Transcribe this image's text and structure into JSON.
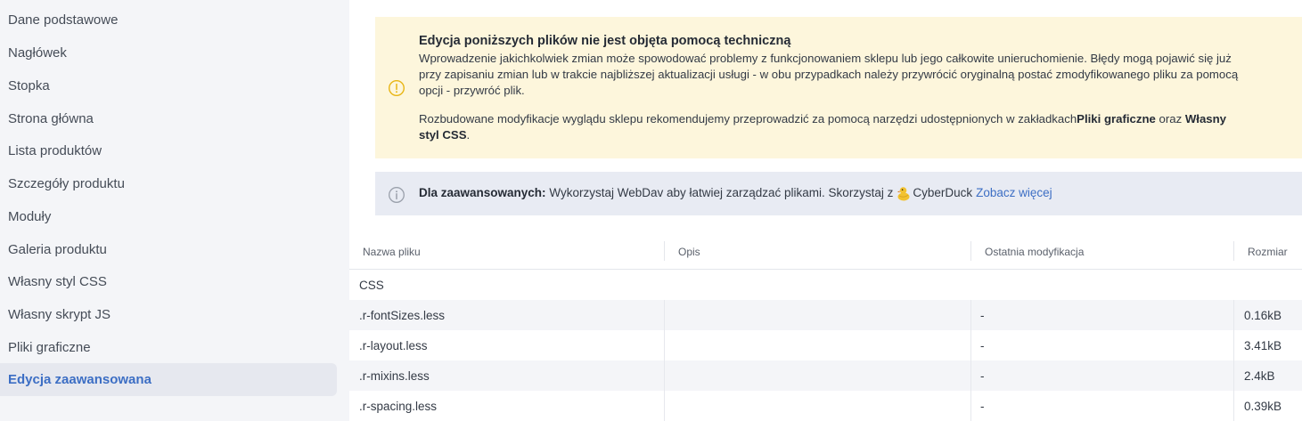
{
  "sidebar": {
    "items": [
      {
        "label": "Dane podstawowe"
      },
      {
        "label": "Nagłówek"
      },
      {
        "label": "Stopka"
      },
      {
        "label": "Strona główna"
      },
      {
        "label": "Lista produktów"
      },
      {
        "label": "Szczegóły produktu"
      },
      {
        "label": "Moduły"
      },
      {
        "label": "Galeria produktu"
      },
      {
        "label": "Własny styl CSS"
      },
      {
        "label": "Własny skrypt JS"
      },
      {
        "label": "Pliki graficzne"
      },
      {
        "label": "Edycja zaawansowana",
        "active": true
      }
    ]
  },
  "warning": {
    "title": "Edycja poniższych plików nie jest objęta pomocą techniczną",
    "text": "Wprowadzenie jakichkolwiek zmian może spowodować problemy z funkcjonowaniem sklepu lub jego całkowite unieruchomienie. Błędy mogą pojawić się już przy zapisaniu zmian lub w trakcie najbliższej aktualizacji usługi - w obu przypadkach należy przywrócić oryginalną postać zmodyfikowanego pliku za pomocą opcji - przywróć plik.",
    "text2_prefix": "Rozbudowane modyfikacje wyglądu sklepu rekomendujemy przeprowadzić za pomocą narzędzi udostępnionych w zakładkach",
    "link1": "Pliki graficzne",
    "text2_mid": " oraz ",
    "link2": "Własny styl CSS",
    "text2_suffix": ".",
    "icon_color": "#e8b514"
  },
  "info": {
    "label": "Dla zaawansowanych:",
    "text": "Wykorzystaj WebDav aby łatwiej zarządzać plikami. Skorzystaj z",
    "cyberduck": "CyberDuck",
    "link": "Zobacz więcej",
    "link_color": "#3c6ec4"
  },
  "table": {
    "headers": {
      "name": "Nazwa pliku",
      "desc": "Opis",
      "modified": "Ostatnia modyfikacja",
      "size": "Rozmiar"
    },
    "group": "CSS",
    "rows": [
      {
        "name": ".r-fontSizes.less",
        "desc": "",
        "modified": "-",
        "size": "0.16kB"
      },
      {
        "name": ".r-layout.less",
        "desc": "",
        "modified": "-",
        "size": "3.41kB"
      },
      {
        "name": ".r-mixins.less",
        "desc": "",
        "modified": "-",
        "size": "2.4kB"
      },
      {
        "name": ".r-spacing.less",
        "desc": "",
        "modified": "-",
        "size": "0.39kB"
      }
    ]
  }
}
